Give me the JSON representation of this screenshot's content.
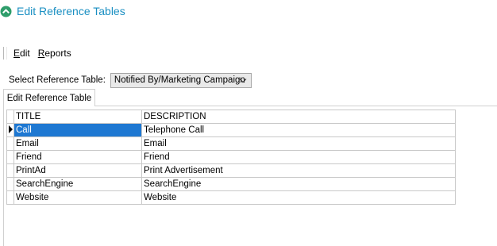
{
  "window": {
    "title": "Edit Reference Tables",
    "icon": "chevron-up-circle-icon",
    "accent_color": "#1a8fc2",
    "icon_color": "#2e9d6a"
  },
  "menu": {
    "items": [
      {
        "accel": "E",
        "rest": "dit",
        "name": "edit"
      },
      {
        "accel": "R",
        "rest": "eports",
        "name": "reports"
      }
    ]
  },
  "reference_select": {
    "label": "Select Reference Table:",
    "selected": "Notified By/Marketing Campaign"
  },
  "tabs": [
    {
      "label": "Edit Reference Table",
      "active": true
    }
  ],
  "grid": {
    "columns": [
      "TITLE",
      "DESCRIPTION"
    ],
    "selected_color": "#1e78d2",
    "rows": [
      {
        "title": "Call",
        "description": "Telephone Call",
        "current": true
      },
      {
        "title": "Email",
        "description": "Email"
      },
      {
        "title": "Friend",
        "description": "Friend"
      },
      {
        "title": "PrintAd",
        "description": "Print Advertisement"
      },
      {
        "title": "SearchEngine",
        "description": "SearchEngine"
      },
      {
        "title": "Website",
        "description": "Website"
      }
    ]
  }
}
